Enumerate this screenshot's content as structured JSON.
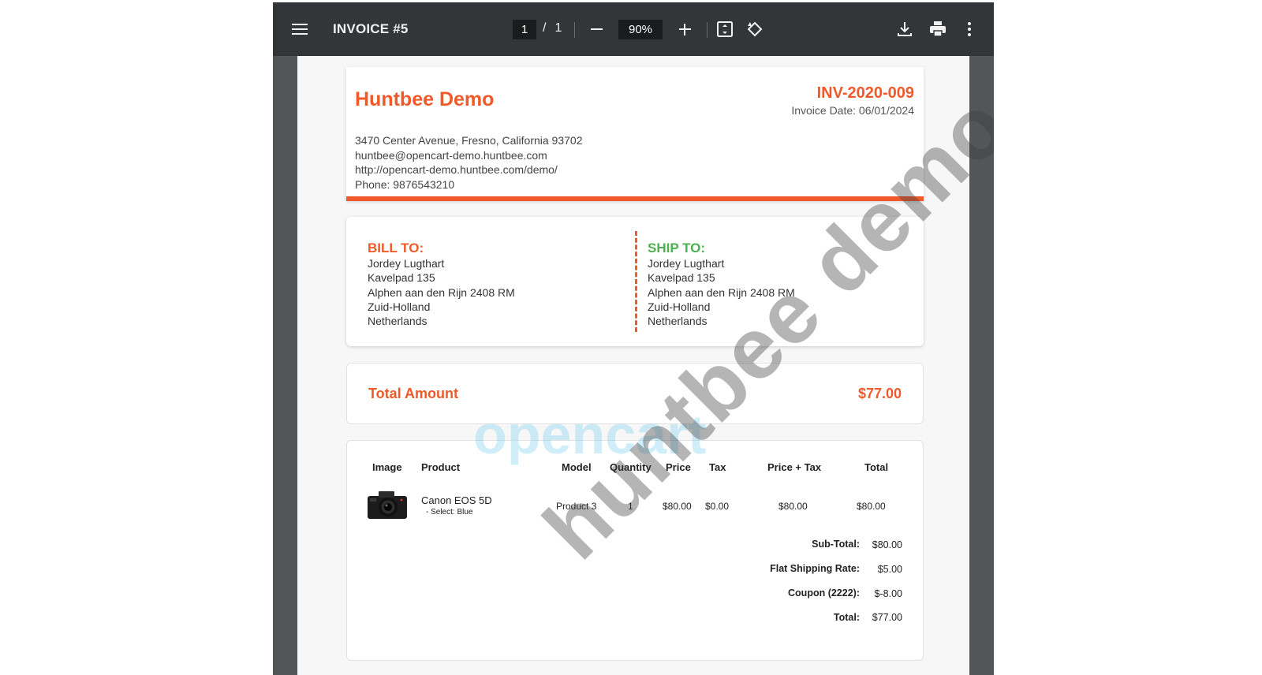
{
  "toolbar": {
    "title": "INVOICE #5",
    "page_current": "1",
    "page_separator": "/",
    "page_total": "1",
    "zoom": "90%"
  },
  "invoice": {
    "store_name": "Huntbee Demo",
    "number": "INV-2020-009",
    "date": "Invoice Date: 06/01/2024",
    "store_lines": [
      "3470 Center Avenue, Fresno, California 93702",
      "huntbee@opencart-demo.huntbee.com",
      "http://opencart-demo.huntbee.com/demo/",
      "Phone: 9876543210"
    ],
    "bill_to": {
      "heading": "BILL TO:",
      "lines": [
        "Jordey Lugthart",
        "Kavelpad 135",
        "Alphen aan den Rijn 2408 RM",
        "Zuid-Holland",
        "Netherlands"
      ]
    },
    "ship_to": {
      "heading": "SHIP TO:",
      "lines": [
        "Jordey Lugthart",
        "Kavelpad 135",
        "Alphen aan den Rijn 2408 RM",
        "Zuid-Holland",
        "Netherlands"
      ]
    },
    "total_label": "Total Amount",
    "total_value": "$77.00",
    "columns": {
      "image": "Image",
      "product": "Product",
      "model": "Model",
      "quantity": "Quantity",
      "price": "Price",
      "tax": "Tax",
      "price_tax": "Price + Tax",
      "total": "Total"
    },
    "item": {
      "name": "Canon EOS 5D",
      "option": "- Select: Blue",
      "model": "Product 3",
      "quantity": "1",
      "price": "$80.00",
      "tax": "$0.00",
      "price_tax": "$80.00",
      "total": "$80.00"
    },
    "summary": [
      {
        "label": "Sub-Total:",
        "value": "$80.00"
      },
      {
        "label": "Flat Shipping Rate:",
        "value": "$5.00"
      },
      {
        "label": "Coupon (2222):",
        "value": "$-8.00"
      },
      {
        "label": "Total:",
        "value": "$77.00"
      }
    ]
  },
  "watermark": {
    "text": "huntbee demo",
    "logo_text": "opencart"
  },
  "colors": {
    "accent": "#f0592a",
    "ship_heading": "#4cb050",
    "toolbar": "#323639",
    "viewer_bg": "#525659"
  }
}
